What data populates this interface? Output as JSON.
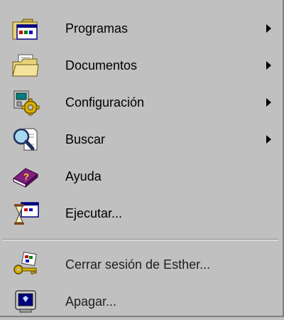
{
  "menu": {
    "items": [
      {
        "label": "Programas",
        "icon": "programs-folder-icon",
        "has_submenu": true
      },
      {
        "label": "Documentos",
        "icon": "documents-folder-icon",
        "has_submenu": true
      },
      {
        "label": "Configuración",
        "icon": "settings-gear-icon",
        "has_submenu": true
      },
      {
        "label": "Buscar",
        "icon": "search-magnifier-icon",
        "has_submenu": true
      },
      {
        "label": "Ayuda",
        "icon": "help-book-icon",
        "has_submenu": false
      },
      {
        "label": "Ejecutar...",
        "icon": "run-hourglass-icon",
        "has_submenu": false
      }
    ],
    "session_items": [
      {
        "label": "Cerrar sesión de Esther...",
        "icon": "logoff-key-icon"
      },
      {
        "label": "Apagar...",
        "icon": "shutdown-computer-icon"
      }
    ]
  },
  "colors": {
    "menu_background": "#c0c0c0",
    "text": "#000000"
  }
}
